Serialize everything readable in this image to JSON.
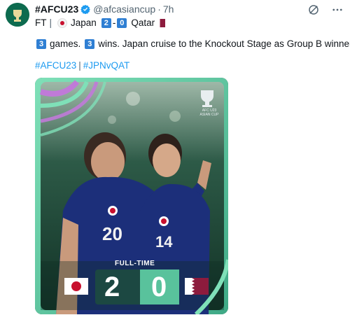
{
  "post": {
    "account_name": "#AFCU23",
    "handle": "@afcasiancup",
    "separator_dot": "·",
    "time": "7h",
    "line1": {
      "prefix": "FT",
      "pipe": "|",
      "team_home": "Japan",
      "score_home": "2",
      "score_dash": "-",
      "score_away": "0",
      "team_away": "Qatar"
    },
    "line2": {
      "games_count": "3",
      "games_text": "games.",
      "wins_count": "3",
      "wins_text": "wins. Japan cruise to the Knockout Stage as Group B winners!"
    },
    "line3": {
      "hashtag1": "#AFCU23",
      "pipe": "|",
      "hashtag2": "#JPNvQAT"
    }
  },
  "media": {
    "badge_title": "AFC U23",
    "badge_sub": "ASIAN CUP",
    "label": "FULL-TIME",
    "score_home": "2",
    "score_away": "0",
    "jersey_left": "20",
    "jersey_right": "14"
  },
  "colors": {
    "accent_blue": "#1d9bf0",
    "score_box": "#2f7fd3",
    "japan_red": "#c8102e",
    "qatar_maroon": "#8d1b3d",
    "card_green": "#5fc6a2",
    "jersey_blue": "#1c2f7a"
  },
  "icons": [
    "afc-logo-avatar",
    "verified-badge-icon",
    "grok-icon",
    "more-icon",
    "japan-flag-icon",
    "qatar-flag-icon"
  ]
}
